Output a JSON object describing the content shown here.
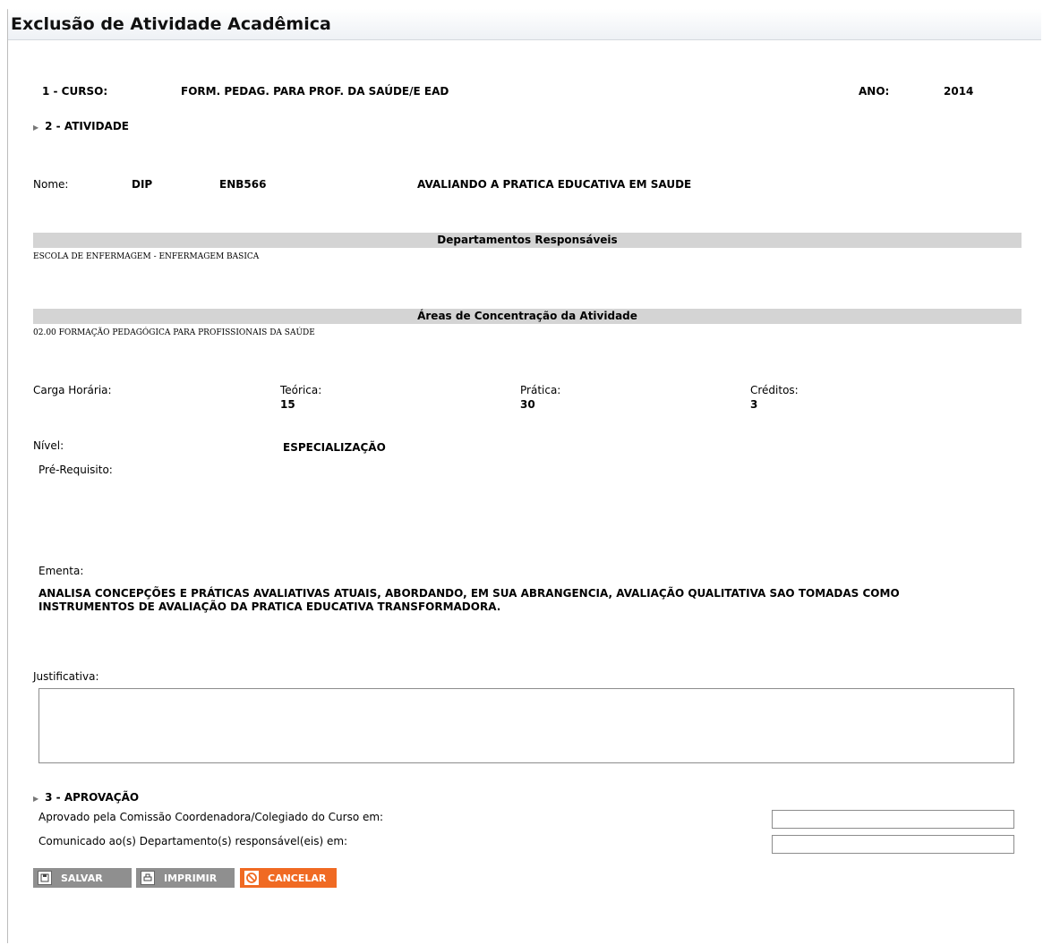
{
  "page": {
    "title": "Exclusão de Atividade Acadêmica"
  },
  "curso": {
    "label": "1 - CURSO:",
    "value": "FORM. PEDAG. PARA PROF. DA SAÚDE/E EAD",
    "ano_label": "ANO:",
    "ano_value": "2014"
  },
  "atividade": {
    "section_label": "2 - ATIVIDADE",
    "nome_label": "Nome:",
    "sigla": "DIP",
    "codigo": "ENB566",
    "nome": "AVALIANDO A PRATICA EDUCATIVA EM SAUDE"
  },
  "departamentos": {
    "header": "Departamentos Responsáveis",
    "value": "ESCOLA DE ENFERMAGEM - ENFERMAGEM BASICA"
  },
  "areas": {
    "header": "Áreas de Concentração da Atividade",
    "value": "02.00 FORMAÇÃO PEDAGÓGICA PARA PROFISSIONAIS DA SAÚDE"
  },
  "carga": {
    "label": "Carga Horária:",
    "teorica_label": "Teórica:",
    "teorica_value": "15",
    "pratica_label": "Prática:",
    "pratica_value": "30",
    "creditos_label": "Créditos:",
    "creditos_value": "3"
  },
  "nivel": {
    "label": "Nível:",
    "value": "ESPECIALIZAÇÃO"
  },
  "prerequisito": {
    "label": "Pré-Requisito:"
  },
  "ementa": {
    "label": "Ementa:",
    "line1": "ANALISA CONCEPÇÕES E PRÁTICAS AVALIATIVAS ATUAIS, ABORDANDO, EM SUA ABRANGENCIA, AVALIAÇÃO QUALITATIVA SAO TOMADAS COMO",
    "line2": "INSTRUMENTOS DE AVALIAÇÃO DA PRATICA EDUCATIVA TRANSFORMADORA."
  },
  "justificativa": {
    "label": "Justificativa:",
    "value": ""
  },
  "aprovacao": {
    "section_label": "3 - APROVAÇÃO",
    "aprovado_label": "Aprovado pela Comissão Coordenadora/Colegiado do Curso em:",
    "aprovado_value": "",
    "comunicado_label": "Comunicado ao(s) Departamento(s) responsável(eis) em:",
    "comunicado_value": ""
  },
  "buttons": {
    "salvar": "SALVAR",
    "imprimir": "IMPRIMIR",
    "cancelar": "CANCELAR"
  },
  "colors": {
    "button_gray": "#8f8f8f",
    "button_orange": "#f06a23",
    "section_band": "#d4d4d4"
  },
  "icons": {
    "salvar": "save-icon",
    "imprimir": "print-icon",
    "cancelar": "cancel-icon",
    "section": "triangle-right-icon"
  }
}
